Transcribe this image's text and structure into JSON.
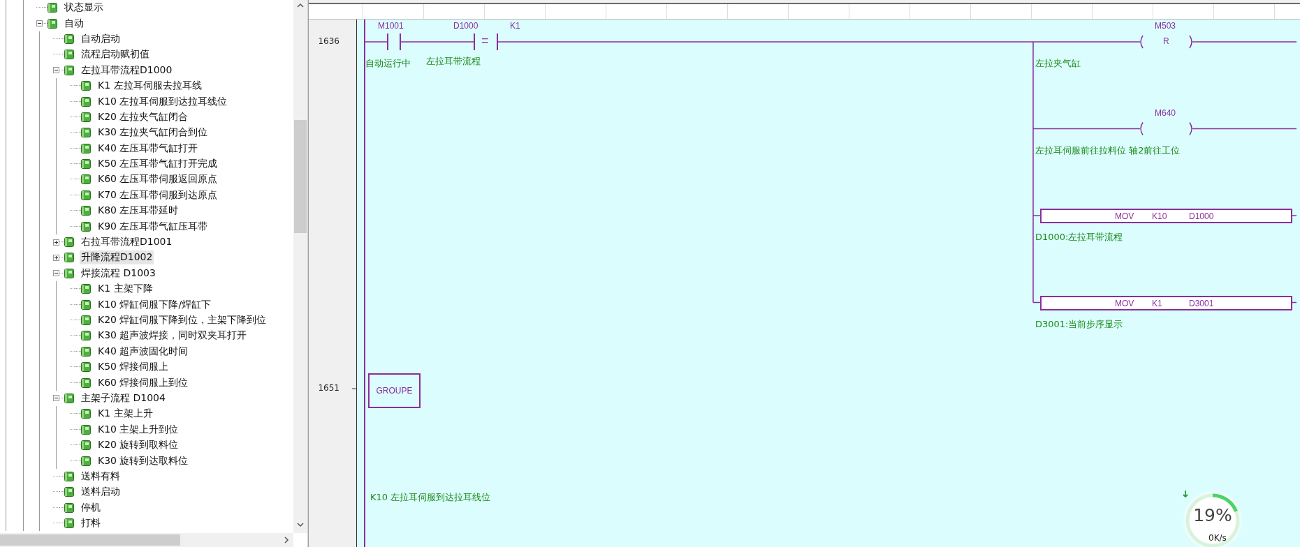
{
  "tree": {
    "items": [
      {
        "label": "状态显示",
        "selected": false
      },
      {
        "label": "自动",
        "selected": false,
        "expanded": true,
        "children": [
          {
            "label": "自动启动",
            "selected": false
          },
          {
            "label": "流程启动赋初值",
            "selected": false
          },
          {
            "label": "左拉耳带流程D1000",
            "selected": false,
            "expanded": true,
            "children": [
              {
                "label": "K1 左拉耳伺服去拉耳线",
                "selected": false
              },
              {
                "label": "K10 左拉耳伺服到达拉耳线位",
                "selected": false
              },
              {
                "label": "K20 左拉夹气缸闭合",
                "selected": false
              },
              {
                "label": "K30 左拉夹气缸闭合到位",
                "selected": false
              },
              {
                "label": "K40 左压耳带气缸打开",
                "selected": false
              },
              {
                "label": "K50 左压耳带气缸打开完成",
                "selected": false
              },
              {
                "label": "K60 左压耳带伺服返回原点",
                "selected": false
              },
              {
                "label": "K70 左压耳带伺服到达原点",
                "selected": false
              },
              {
                "label": "K80 左压耳带延时",
                "selected": false
              },
              {
                "label": "K90 左压耳带气缸压耳带",
                "selected": false
              }
            ]
          },
          {
            "label": "右拉耳带流程D1001",
            "selected": false,
            "expanded": false
          },
          {
            "label": "升降流程D1002",
            "selected": true,
            "expanded": false
          },
          {
            "label": "焊接流程 D1003",
            "selected": false,
            "expanded": true,
            "children": [
              {
                "label": "K1 主架下降",
                "selected": false
              },
              {
                "label": "K10 焊缸伺服下降/焊缸下",
                "selected": false
              },
              {
                "label": "K20 焊缸伺服下降到位，主架下降到位",
                "selected": false
              },
              {
                "label": "K30 超声波焊接，同时双夹耳打开",
                "selected": false
              },
              {
                "label": "K40 超声波固化时间",
                "selected": false
              },
              {
                "label": "K50 焊接伺服上",
                "selected": false
              },
              {
                "label": "K60 焊接伺服上到位",
                "selected": false
              }
            ]
          },
          {
            "label": "主架子流程 D1004",
            "selected": false,
            "expanded": true,
            "children": [
              {
                "label": "K1 主架上升",
                "selected": false
              },
              {
                "label": "K10 主架上升到位",
                "selected": false
              },
              {
                "label": "K20 旋转到取料位",
                "selected": false
              },
              {
                "label": "K30 旋转到达取料位",
                "selected": false
              }
            ]
          },
          {
            "label": "送料有料",
            "selected": false
          },
          {
            "label": "送料启动",
            "selected": false
          },
          {
            "label": "停机",
            "selected": false
          },
          {
            "label": "打料",
            "selected": false
          }
        ]
      }
    ]
  },
  "ladder": {
    "rungs": [
      {
        "kind": "logic",
        "number": "1636",
        "inputs": [
          {
            "kind": "contact",
            "operand": "M1001",
            "comment": "自动运行中"
          },
          {
            "kind": "compare",
            "operator": "=",
            "operand_1": "D1000",
            "operand_2": "K1",
            "comment": "左拉耳带流程"
          }
        ],
        "outputs": [
          {
            "kind": "coil",
            "operand": "M503",
            "function": "R",
            "comment": "左拉夹气缸"
          },
          {
            "kind": "coil",
            "operand": "M640",
            "comment": "左拉耳伺服前往拉料位 轴2前往工位"
          },
          {
            "kind": "instruction",
            "mnemonic": "MOV",
            "args": [
              "K10",
              "D1000"
            ],
            "comment": "D1000:左拉耳带流程"
          },
          {
            "kind": "instruction",
            "mnemonic": "MOV",
            "args": [
              "K1",
              "D3001"
            ],
            "comment": "D3001:当前步序显示"
          }
        ]
      },
      {
        "kind": "group",
        "number": "1651",
        "label": "GROUPE",
        "comment": "K10 左拉耳伺服到达拉耳线位"
      }
    ]
  },
  "network_meter": {
    "percent": "19%",
    "speed": "0K/s",
    "level": 0.19
  }
}
